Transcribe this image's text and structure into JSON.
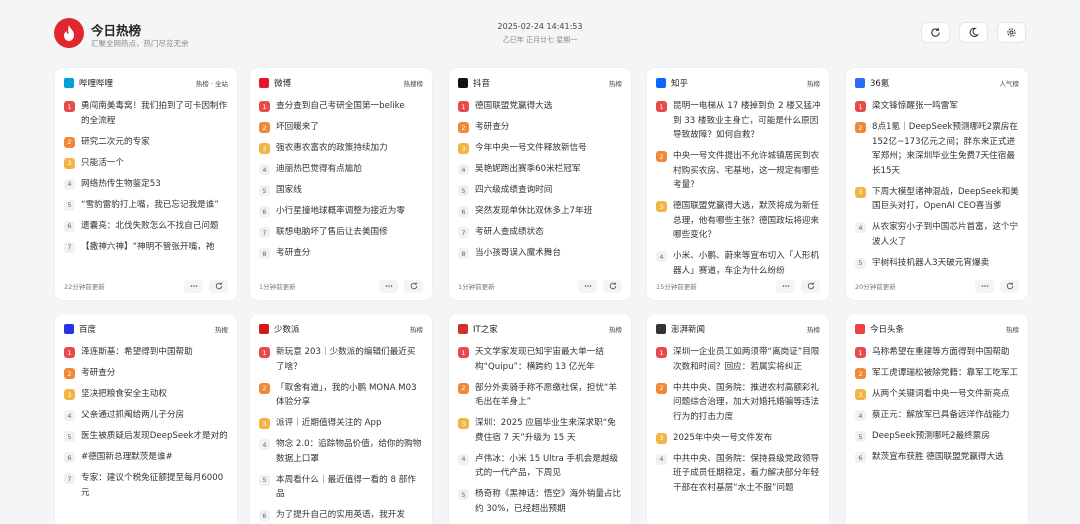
{
  "header": {
    "title": "今日热榜",
    "subtitle": "汇聚全网热点，热门尽览无余",
    "datetime": "2025-02-24 14:41:53",
    "lunar": "乙巳年 正月廿七 星期一"
  },
  "colors": {
    "brand": "#e3262e",
    "rank1": "#e94a4a",
    "rank2": "#f0883a",
    "rank3": "#f2b544"
  },
  "cards": [
    {
      "name": "哔哩哔哩",
      "type": "热榜 · 全站",
      "updated": "22分钟前更新",
      "icon": "bilibili-icon",
      "icon_color": "#00a1d6",
      "items": [
        {
          "rank": "1",
          "title": "勇闯南美毒窝！我们拍到了可卡因制作的全流程"
        },
        {
          "rank": "2",
          "title": "研究二次元的专家"
        },
        {
          "rank": "3",
          "title": "只能活一个"
        },
        {
          "rank": "4",
          "title": "网络热传生物鉴定53"
        },
        {
          "rank": "5",
          "title": "“雪豹雷豹打上嘴，我已忘记我是谁”"
        },
        {
          "rank": "6",
          "title": "遗囊亮：北伐失败怎么不找自己问题"
        },
        {
          "rank": "7",
          "title": "【撒神六神】“神明不管张开嘴，祂"
        }
      ]
    },
    {
      "name": "微博",
      "type": "热搜榜",
      "updated": "1分钟前更新",
      "icon": "weibo-icon",
      "icon_color": "#e6162d",
      "items": [
        {
          "rank": "1",
          "title": "查分查到自己考研全国第一belike"
        },
        {
          "rank": "2",
          "title": "坏回暖来了"
        },
        {
          "rank": "3",
          "title": "强农惠农富农的政策持续加力"
        },
        {
          "rank": "4",
          "title": "迪丽热巴觉得有点尴尬"
        },
        {
          "rank": "5",
          "title": "国家线"
        },
        {
          "rank": "6",
          "title": "小行星撞地球概率调整为接近为零"
        },
        {
          "rank": "7",
          "title": "联想电脑坏了售后让去美国修"
        },
        {
          "rank": "8",
          "title": "考研查分"
        }
      ]
    },
    {
      "name": "抖音",
      "type": "热榜",
      "updated": "1分钟前更新",
      "icon": "douyin-icon",
      "icon_color": "#111111",
      "items": [
        {
          "rank": "1",
          "title": "德国联盟党赢得大选"
        },
        {
          "rank": "2",
          "title": "考研查分"
        },
        {
          "rank": "3",
          "title": "今年中央一号文件释放新信号"
        },
        {
          "rank": "4",
          "title": "吴艳妮跑出赛季60米栏冠军"
        },
        {
          "rank": "5",
          "title": "四六级成绩查询时间"
        },
        {
          "rank": "6",
          "title": "突然发现单休比双休多上7年班"
        },
        {
          "rank": "7",
          "title": "考研人查成绩状态"
        },
        {
          "rank": "8",
          "title": "当小孩哥误入魔术舞台"
        }
      ]
    },
    {
      "name": "知乎",
      "type": "热榜",
      "updated": "15分钟前更新",
      "icon": "zhihu-icon",
      "icon_color": "#0a66ff",
      "items": [
        {
          "rank": "1",
          "title": "昆明一电梯从 17 楼掉到负 2 楼又猛冲到 33 楼致业主身亡，可能是什么原因导致故障？如何自救？"
        },
        {
          "rank": "2",
          "title": "中央一号文件提出不允许城镇居民到农村购买农房、宅基地，这一规定有哪些考量？"
        },
        {
          "rank": "3",
          "title": "德国联盟党赢得大选，默茨将成为新任总理，他有哪些主张？德国政坛将迎来哪些变化？"
        },
        {
          "rank": "4",
          "title": "小米、小鹏、蔚来等宣布切入「人形机器人」赛道，车企为什么纷纷"
        }
      ]
    },
    {
      "name": "36氪",
      "type": "人气榜",
      "updated": "20分钟前更新",
      "icon": "36kr-icon",
      "icon_color": "#2d6cf5",
      "items": [
        {
          "rank": "1",
          "title": "梁文锋惊醒张一鸣雷军"
        },
        {
          "rank": "2",
          "title": "8点1氪｜DeepSeek预测哪吒2票房在152亿~173亿元之间；胖东来正式进军郑州；来深圳毕业生免费7天住宿最长15天"
        },
        {
          "rank": "3",
          "title": "下周大模型诸神混战，DeepSeek和美国巨头对打，OpenAI CEO喜当爹"
        },
        {
          "rank": "4",
          "title": "从农家穷小子到中国芯片首富，这个宁波人火了"
        },
        {
          "rank": "5",
          "title": "宇树科技机器人3天破元宵爆卖"
        }
      ]
    },
    {
      "name": "百度",
      "type": "热搜",
      "updated": "",
      "icon": "baidu-icon",
      "icon_color": "#2932e1",
      "items": [
        {
          "rank": "1",
          "title": "泽连斯基：希望得到中国帮助"
        },
        {
          "rank": "2",
          "title": "考研查分"
        },
        {
          "rank": "3",
          "title": "坚决把粮食安全主动权"
        },
        {
          "rank": "4",
          "title": "父亲通过抓阄给两儿子分房"
        },
        {
          "rank": "5",
          "title": "医生被质疑后发现DeepSeek才是对的"
        },
        {
          "rank": "6",
          "title": "#德国新总理默茨是谁#"
        },
        {
          "rank": "7",
          "title": "专家：建议个税免征额提至每月6000元"
        }
      ]
    },
    {
      "name": "少数派",
      "type": "热榜",
      "updated": "",
      "icon": "sspai-icon",
      "icon_color": "#d7191a",
      "items": [
        {
          "rank": "1",
          "title": "新玩意 203｜少数派的编辑们最近买了啥？"
        },
        {
          "rank": "2",
          "title": "「取舍有道」，我的小鹏 MONA M03 体验分享"
        },
        {
          "rank": "3",
          "title": "派评｜近期值得关注的 App"
        },
        {
          "rank": "4",
          "title": "物念 2.0：追踪物品价值，给你的购物数据上口罩"
        },
        {
          "rank": "5",
          "title": "本周看什么｜最近值得一看的 8 部作品"
        },
        {
          "rank": "6",
          "title": "为了提升自己的实用英语，我开发"
        }
      ]
    },
    {
      "name": "IT之家",
      "type": "热榜",
      "updated": "",
      "icon": "ithome-icon",
      "icon_color": "#d32f2f",
      "items": [
        {
          "rank": "1",
          "title": "天文学家发现已知宇宙最大单一结构“Quipu”：横跨约 13 亿光年"
        },
        {
          "rank": "2",
          "title": "部分外卖骑手称不愿缴社保，担忧“羊毛出在羊身上”"
        },
        {
          "rank": "3",
          "title": "深圳：2025 应届毕业生来深求职“免费住宿 7 天”升级为 15 天"
        },
        {
          "rank": "4",
          "title": "卢伟冰：小米 15 Ultra 手机会是越级式的一代产品，下周见"
        },
        {
          "rank": "5",
          "title": "杨奇称《黑神话：悟空》海外销量占比约 30%，已经超出预期"
        }
      ]
    },
    {
      "name": "澎湃新闻",
      "type": "热榜",
      "updated": "",
      "icon": "thepaper-icon",
      "icon_color": "#333333",
      "items": [
        {
          "rank": "1",
          "title": "深圳一企业员工如两须带“离岗证”目限次数和时间？回应：若属实将纠正"
        },
        {
          "rank": "2",
          "title": "中共中央、国务院：推进农村高额彩礼问题综合治理，加大对婚托婚骗等违法行为的打击力度"
        },
        {
          "rank": "3",
          "title": "2025年中央一号文件发布"
        },
        {
          "rank": "4",
          "title": "中共中央、国务院：保持县级党政领导班子成员任期稳定，着力解决部分年轻干部在农村基层“水土不服”问题"
        }
      ]
    },
    {
      "name": "今日头条",
      "type": "热榜",
      "updated": "",
      "icon": "toutiao-icon",
      "icon_color": "#f04142",
      "items": [
        {
          "rank": "1",
          "title": "乌称希望在重建等方面得到中国帮助"
        },
        {
          "rank": "2",
          "title": "军工虎谭瑞松被除党籍：靠军工吃军工"
        },
        {
          "rank": "3",
          "title": "从两个关键词看中央一号文件新亮点"
        },
        {
          "rank": "4",
          "title": "蔡正元：解放军已具备远洋作战能力"
        },
        {
          "rank": "5",
          "title": "DeepSeek预测哪吒2最终票房"
        },
        {
          "rank": "6",
          "title": "默茨宣布获胜 德国联盟党赢得大选"
        }
      ]
    }
  ]
}
